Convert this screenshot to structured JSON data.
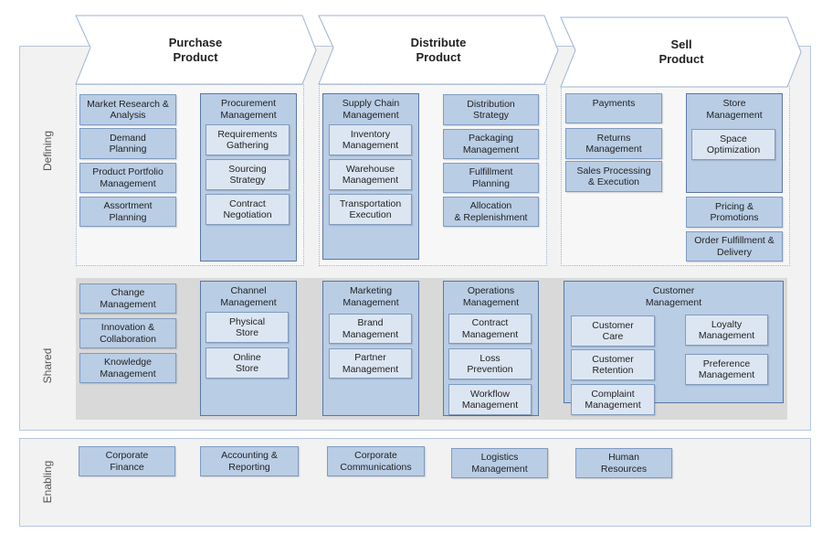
{
  "stages": [
    {
      "title": "Purchase\nProduct"
    },
    {
      "title": "Distribute\nProduct"
    },
    {
      "title": "Sell\nProduct"
    }
  ],
  "layers": {
    "defining": "Defining",
    "shared": "Shared",
    "enabling": "Enabling"
  },
  "defining": {
    "purchase": {
      "left": [
        "Market Research &\nAnalysis",
        "Demand\nPlanning",
        "Product Portfolio\nManagement",
        "Assortment\nPlanning"
      ],
      "procurement": {
        "title": "Procurement\nManagement",
        "items": [
          "Requirements\nGathering",
          "Sourcing\nStrategy",
          "Contract\nNegotiation"
        ]
      }
    },
    "distribute": {
      "supply_chain": {
        "title": "Supply Chain\nManagement",
        "items": [
          "Inventory\nManagement",
          "Warehouse\nManagement",
          "Transportation\nExecution"
        ]
      },
      "right": [
        "Distribution\nStrategy",
        "Packaging\nManagement",
        "Fulfillment\nPlanning",
        "Allocation\n& Replenishment"
      ]
    },
    "sell": {
      "left": [
        "Payments",
        "Returns\nManagement",
        "Sales Processing\n& Execution"
      ],
      "store": {
        "title": "Store\nManagement",
        "items": [
          "Space\nOptimization"
        ]
      },
      "right": [
        "Pricing &\nPromotions",
        "Order Fulfillment &\nDelivery"
      ]
    }
  },
  "shared": {
    "left": [
      "Change\nManagement",
      "Innovation &\nCollaboration",
      "Knowledge\nManagement"
    ],
    "channel": {
      "title": "Channel\nManagement",
      "items": [
        "Physical\nStore",
        "Online\nStore"
      ]
    },
    "marketing": {
      "title": "Marketing\nManagement",
      "items": [
        "Brand\nManagement",
        "Partner\nManagement"
      ]
    },
    "operations": {
      "title": "Operations\nManagement",
      "items": [
        "Contract\nManagement",
        "Loss\nPrevention",
        "Workflow\nManagement"
      ]
    },
    "customer": {
      "title": "Customer\nManagement",
      "items": [
        "Customer\nCare",
        "Customer\nRetention",
        "Complaint\nManagement",
        "Loyalty\nManagement",
        "Preference\nManagement"
      ]
    }
  },
  "enabling": [
    "Corporate\nFinance",
    "Accounting &\nReporting",
    "Corporate\nCommunications",
    "Logistics\nManagement",
    "Human\nResources"
  ],
  "colors": {
    "box": "#b9cde5",
    "inner_box": "#dce6f2",
    "panel": "#f2f2f2",
    "shared_band": "#d9d9d9",
    "border": "#7f9bc0"
  }
}
